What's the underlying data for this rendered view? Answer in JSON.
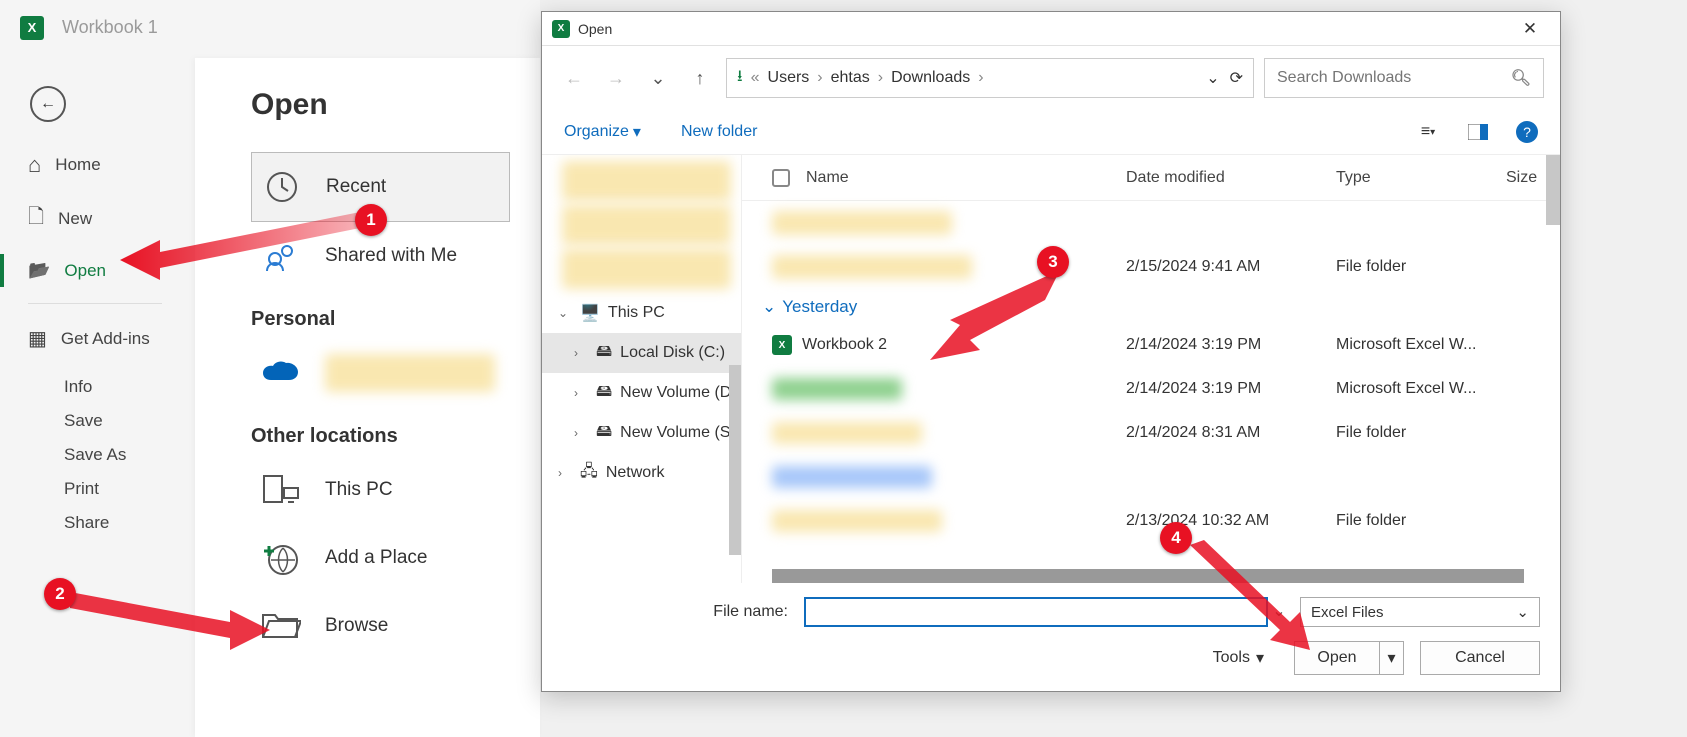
{
  "app": {
    "title": "Workbook 1"
  },
  "backstage": {
    "back_arrow": "←",
    "nav": {
      "home": "Home",
      "new": "New",
      "open": "Open",
      "addins": "Get Add-ins",
      "info": "Info",
      "save": "Save",
      "save_as": "Save As",
      "print": "Print",
      "share": "Share"
    },
    "open_panel": {
      "title": "Open",
      "recent": "Recent",
      "shared": "Shared with Me",
      "personal_hdr": "Personal",
      "other_hdr": "Other locations",
      "this_pc": "This PC",
      "add_place": "Add a Place",
      "browse": "Browse"
    }
  },
  "dialog": {
    "title": "Open",
    "nav": {
      "back": "←",
      "fwd": "→",
      "recent_dd": "⌄",
      "up": "↑"
    },
    "breadcrumbs": {
      "sep1": "«",
      "p1": "Users",
      "p2": "ehtas",
      "p3": "Downloads"
    },
    "refresh": "⟳",
    "search_placeholder": "Search Downloads",
    "toolbar": {
      "organize": "Organize",
      "new_folder": "New folder"
    },
    "tree": {
      "this_pc": "This PC",
      "local_disk": "Local Disk (C:)",
      "nv1": "New Volume (D",
      "nv2": "New Volume (S",
      "network": "Network"
    },
    "columns": {
      "name": "Name",
      "date": "Date modified",
      "type": "Type",
      "size": "Size"
    },
    "group_yesterday": "Yesterday",
    "rows": [
      {
        "name": "",
        "date": "2/15/2024 9:41 AM",
        "type": "File folder",
        "blurred": true
      },
      {
        "name": "Workbook 2",
        "date": "2/14/2024 3:19 PM",
        "type": "Microsoft Excel W...",
        "icon": "excel",
        "blurred": false
      },
      {
        "name": "",
        "date": "2/14/2024 3:19 PM",
        "type": "Microsoft Excel W...",
        "blurred": true
      },
      {
        "name": "",
        "date": "2/14/2024 8:31 AM",
        "type": "File folder",
        "blurred": true
      },
      {
        "name": "",
        "date": "2/13/2024 10:32 AM",
        "type": "File folder",
        "blurred": true
      }
    ],
    "footer": {
      "filename_label": "File name:",
      "filter": "Excel Files",
      "tools": "Tools",
      "open": "Open",
      "cancel": "Cancel"
    }
  },
  "markers": {
    "m1": "1",
    "m2": "2",
    "m3": "3",
    "m4": "4"
  }
}
